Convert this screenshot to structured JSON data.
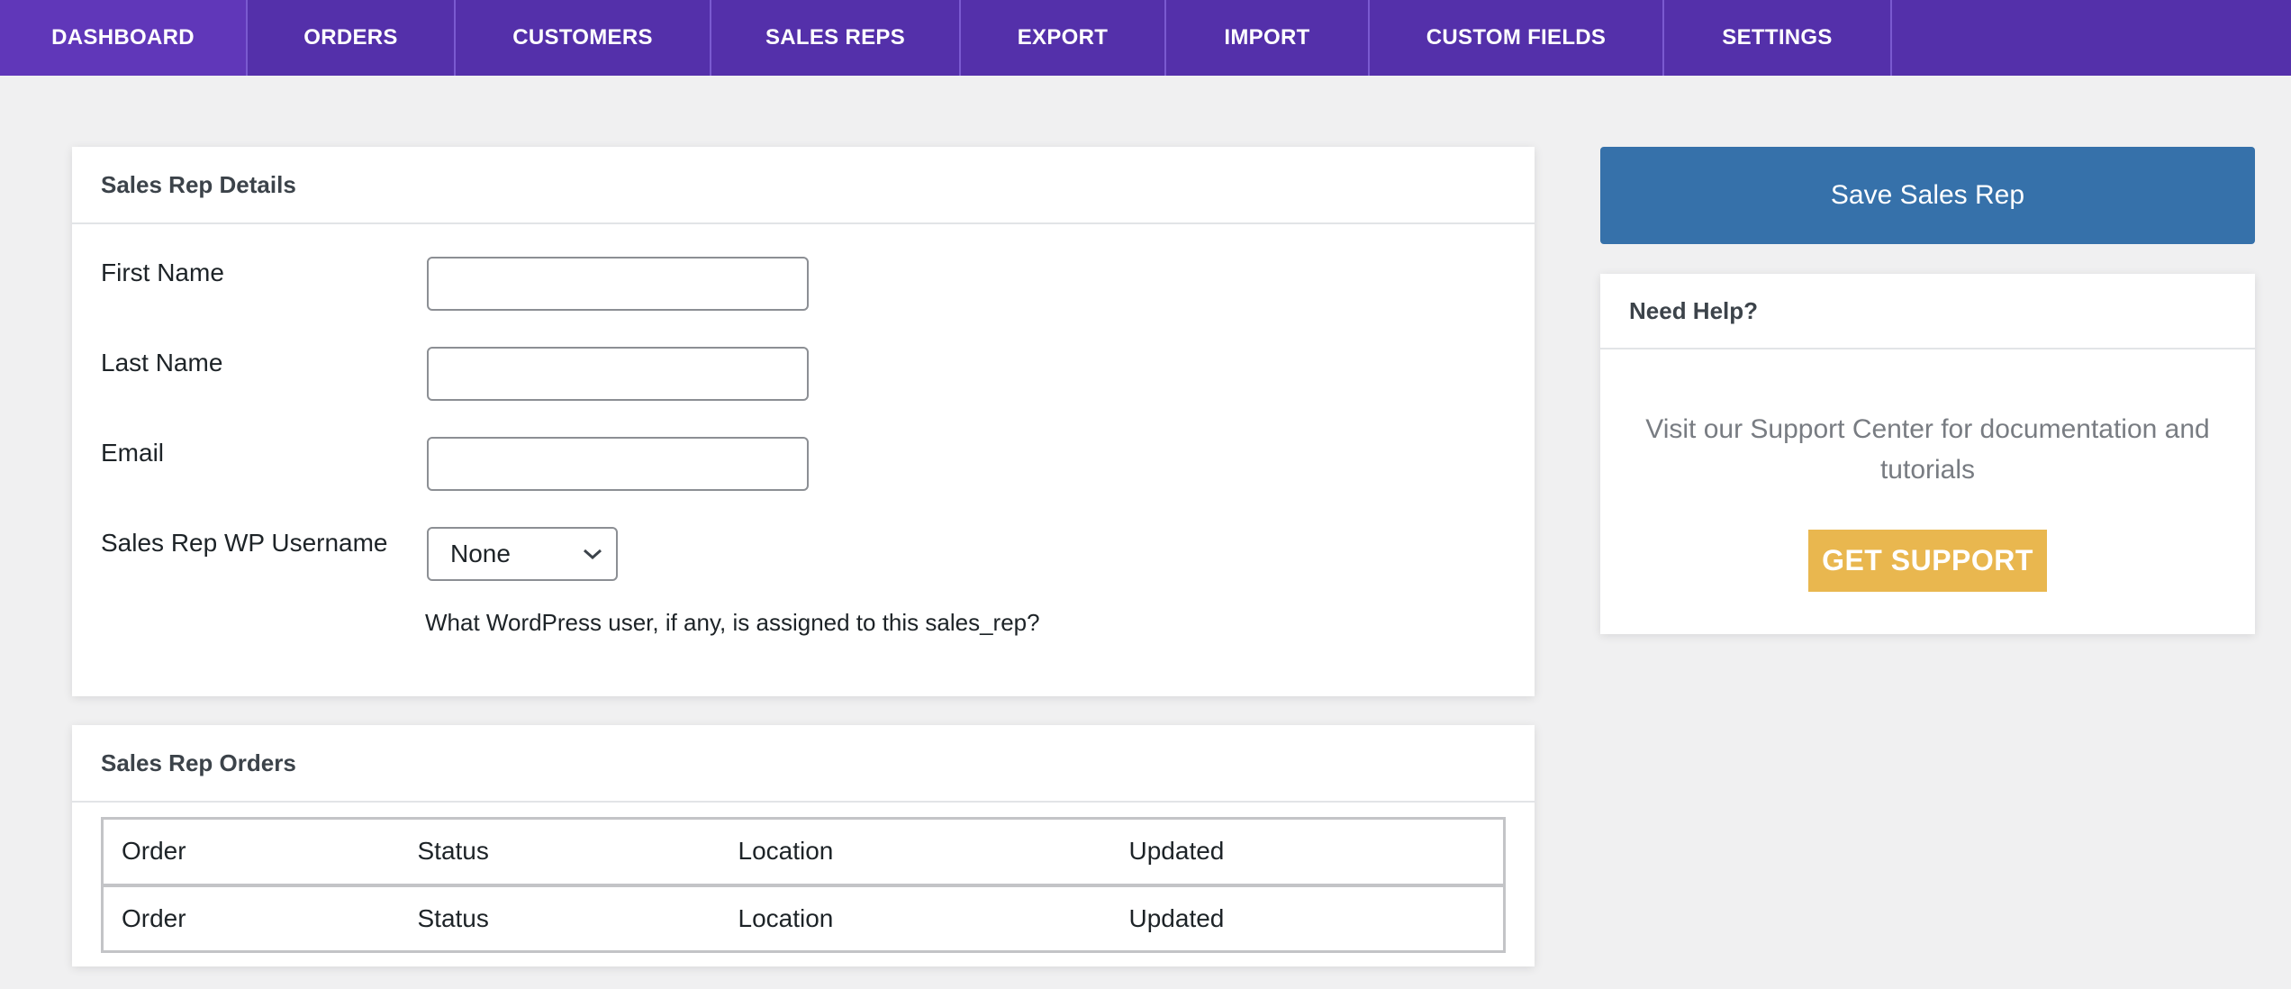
{
  "nav": {
    "items": [
      {
        "label": "DASHBOARD",
        "active": true
      },
      {
        "label": "ORDERS",
        "active": false
      },
      {
        "label": "CUSTOMERS",
        "active": false
      },
      {
        "label": "SALES REPS",
        "active": false
      },
      {
        "label": "EXPORT",
        "active": false
      },
      {
        "label": "IMPORT",
        "active": false
      },
      {
        "label": "CUSTOM FIELDS",
        "active": false
      },
      {
        "label": "SETTINGS",
        "active": false
      }
    ]
  },
  "details": {
    "title": "Sales Rep Details",
    "first_name": {
      "label": "First Name",
      "value": ""
    },
    "last_name": {
      "label": "Last Name",
      "value": ""
    },
    "email": {
      "label": "Email",
      "value": ""
    },
    "wp_username": {
      "label": "Sales Rep WP Username",
      "selected": "None",
      "help": "What WordPress user, if any, is assigned to this sales_rep?"
    }
  },
  "orders": {
    "title": "Sales Rep Orders",
    "columns": [
      "Order",
      "Status",
      "Location",
      "Updated"
    ],
    "rows": [
      [
        "Order",
        "Status",
        "Location",
        "Updated"
      ]
    ]
  },
  "sidebar": {
    "save_label": "Save Sales Rep",
    "help_title": "Need Help?",
    "help_text": "Visit our Support Center for documentation and tutorials",
    "support_label": "GET SUPPORT"
  },
  "colors": {
    "nav_bg": "#5430aa",
    "save_button": "#3671aa",
    "support_button": "#e9b74f",
    "page_bg": "#f0f0f1"
  },
  "icons": {
    "select_chevron": "chevron-down-icon"
  }
}
